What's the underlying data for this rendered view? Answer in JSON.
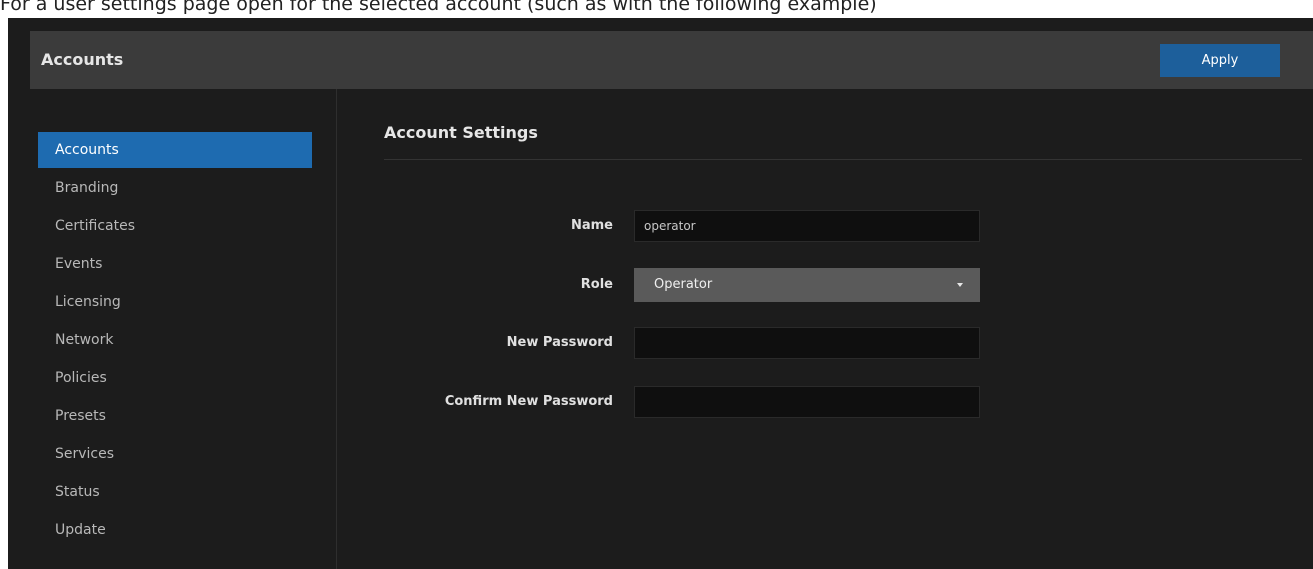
{
  "caption": "For a user settings page open for the selected account (such as with the following example)",
  "header": {
    "title": "Accounts",
    "apply_label": "Apply"
  },
  "sidebar": {
    "items": [
      {
        "label": "Accounts",
        "active": true
      },
      {
        "label": "Branding"
      },
      {
        "label": "Certificates"
      },
      {
        "label": "Events"
      },
      {
        "label": "Licensing"
      },
      {
        "label": "Network"
      },
      {
        "label": "Policies"
      },
      {
        "label": "Presets"
      },
      {
        "label": "Services"
      },
      {
        "label": "Status"
      },
      {
        "label": "Update"
      }
    ]
  },
  "main": {
    "section_title": "Account Settings",
    "form": {
      "name_label": "Name",
      "name_value": "operator",
      "role_label": "Role",
      "role_value": "Operator",
      "new_password_label": "New Password",
      "new_password_value": "",
      "confirm_password_label": "Confirm New Password",
      "confirm_password_value": ""
    }
  },
  "colors": {
    "accent": "#1e6bb0",
    "apply_button": "#1d5f9b",
    "background": "#1c1c1c",
    "header": "#3b3b3b",
    "input": "#0f0f0f",
    "select": "#5a5a5a"
  },
  "icons": {
    "role_dropdown": "caret-down-icon"
  }
}
